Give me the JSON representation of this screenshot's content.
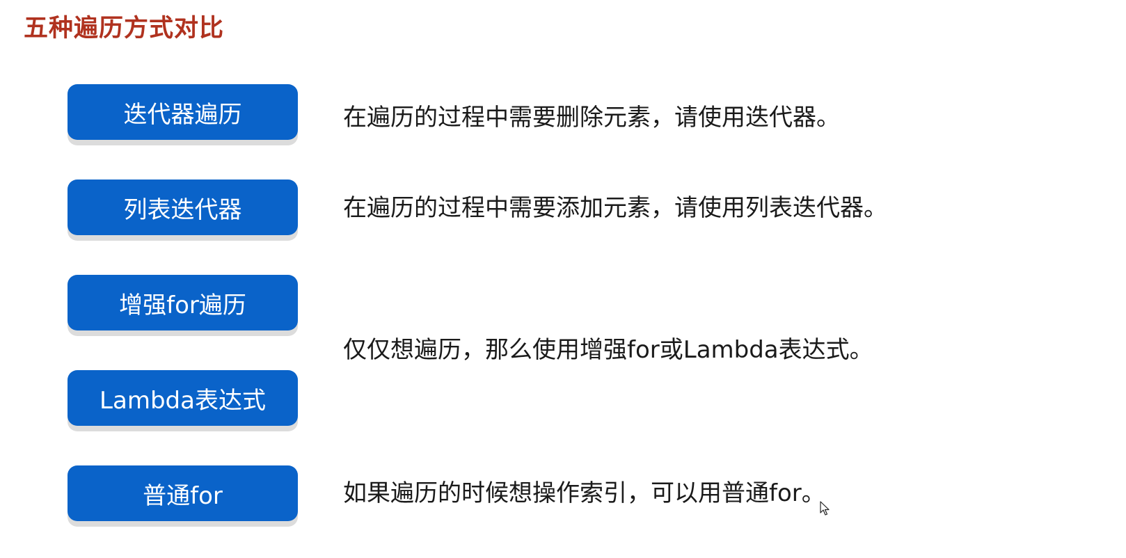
{
  "title": "五种遍历方式对比",
  "methods": [
    {
      "label": "迭代器遍历"
    },
    {
      "label": "列表迭代器"
    },
    {
      "label": "增强for遍历"
    },
    {
      "label": "Lambda表达式"
    },
    {
      "label": "普通for"
    }
  ],
  "descriptions": [
    "在遍历的过程中需要删除元素，请使用迭代器。",
    "在遍历的过程中需要添加元素，请使用列表迭代器。",
    "仅仅想遍历，那么使用增强for或Lambda表达式。",
    "如果遍历的时候想操作索引，可以用普通for。"
  ],
  "colors": {
    "title": "#b0321f",
    "button": "#0a63c9",
    "button_shadow": "#dcdcdc"
  },
  "icons": {
    "cursor": "mouse-pointer-icon"
  }
}
